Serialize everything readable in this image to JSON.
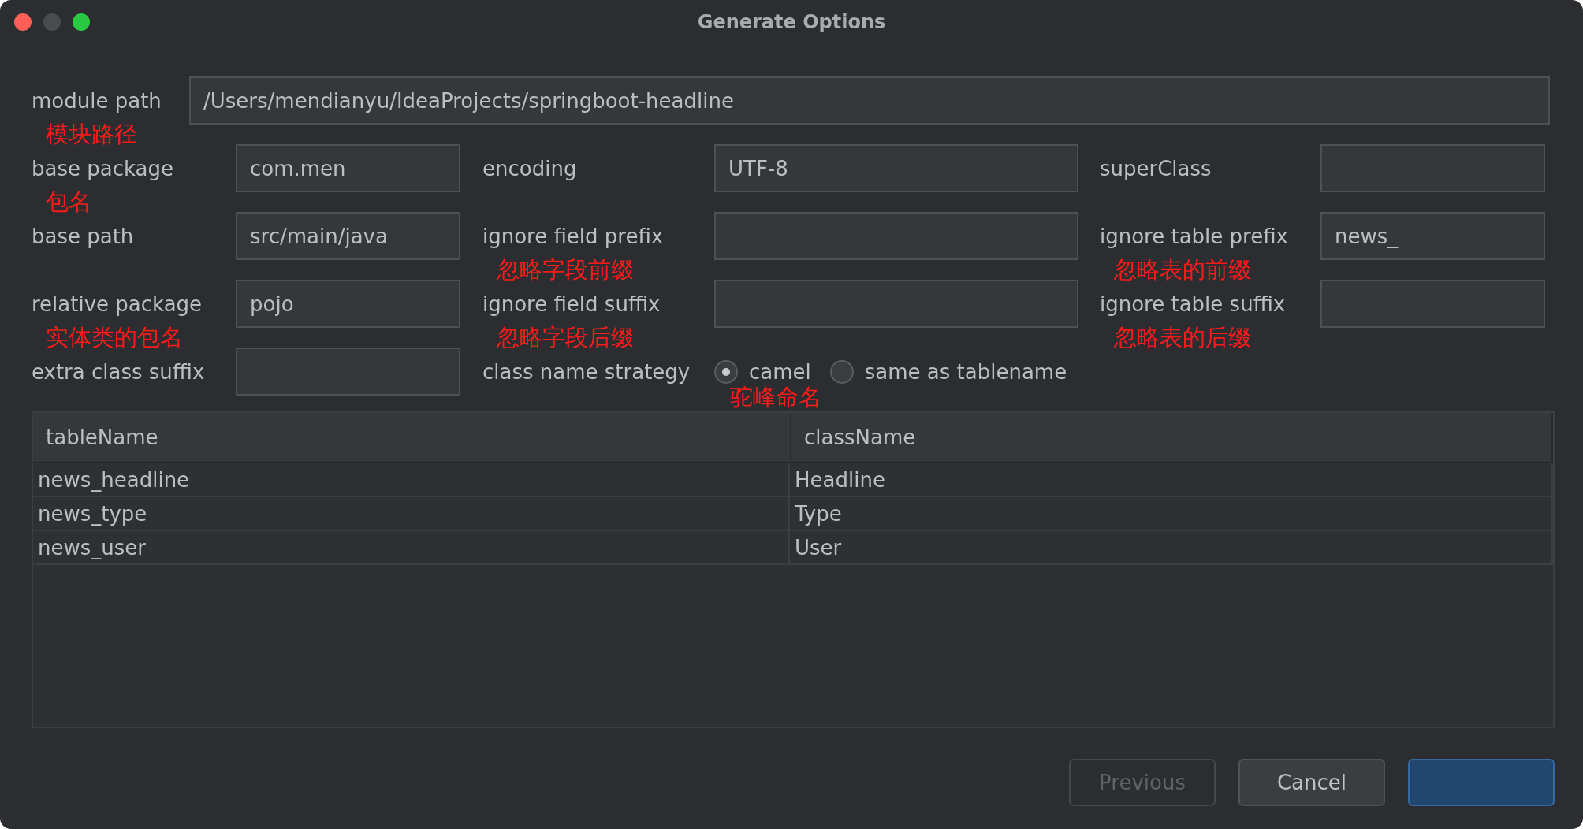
{
  "window": {
    "title": "Generate Options"
  },
  "module_path": {
    "label": "module path",
    "value": "/Users/mendianyu/IdeaProjects/springboot-headline",
    "annotation": "模块路径"
  },
  "rows": [
    [
      {
        "kind": "text",
        "label": "base package",
        "value": "com.men",
        "annotation": "包名"
      },
      {
        "kind": "text",
        "label": "encoding",
        "value": "UTF-8"
      },
      {
        "kind": "text",
        "label": "superClass"
      }
    ],
    [
      {
        "kind": "text",
        "label": "base path",
        "value": "src/main/java"
      },
      {
        "kind": "text",
        "label": "ignore field prefix",
        "annotation": "忽略字段前缀"
      },
      {
        "kind": "text",
        "label": "ignore table prefix",
        "value": "news_",
        "annotation": "忽略表的前缀"
      }
    ],
    [
      {
        "kind": "text",
        "label": "relative package",
        "value": "pojo",
        "annotation": "实体类的包名"
      },
      {
        "kind": "text",
        "label": "ignore field suffix",
        "annotation": "忽略字段后缀"
      },
      {
        "kind": "text",
        "label": "ignore table suffix",
        "annotation": "忽略表的后缀"
      }
    ],
    [
      {
        "kind": "text",
        "label": "extra class suffix"
      },
      {
        "kind": "radio",
        "label": "class name strategy",
        "options": [
          {
            "label": "camel",
            "selected": true,
            "annotation": "驼峰命名"
          },
          {
            "label": "same as tablename",
            "selected": false
          }
        ]
      }
    ]
  ],
  "table": {
    "columns": [
      "tableName",
      "className"
    ],
    "rows": [
      [
        "news_headline",
        "Headline"
      ],
      [
        "news_type",
        "Type"
      ],
      [
        "news_user",
        "User"
      ]
    ]
  },
  "buttons": [
    {
      "kind": "normal",
      "label": "Previous",
      "disabled": true
    },
    {
      "kind": "normal",
      "label": "Cancel",
      "disabled": false
    },
    {
      "kind": "default",
      "disabled": false
    }
  ]
}
